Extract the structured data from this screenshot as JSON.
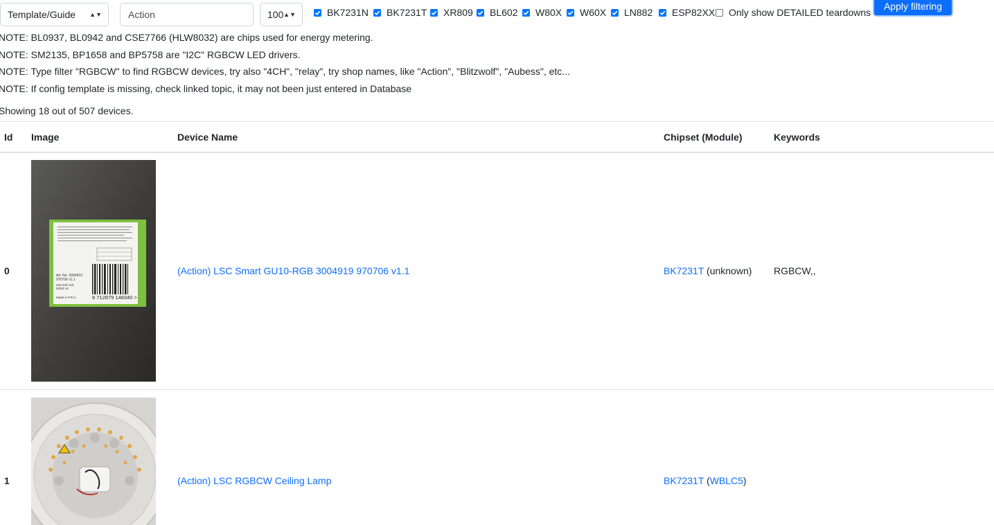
{
  "filters": {
    "template_select": "Template/Guide",
    "search_value": "Action",
    "page_size": "100",
    "chips": [
      {
        "label": "BK7231N",
        "checked": true
      },
      {
        "label": "BK7231T",
        "checked": true
      },
      {
        "label": "XR809",
        "checked": true
      },
      {
        "label": "BL602",
        "checked": true
      },
      {
        "label": "W80X",
        "checked": true
      },
      {
        "label": "W60X",
        "checked": true
      },
      {
        "label": "LN882",
        "checked": true
      },
      {
        "label": "ESP82XX",
        "checked": true
      }
    ],
    "detailed_only_label": "Only show DETAILED teardowns",
    "apply_label": "Apply filtering"
  },
  "notes": [
    "NOTE: BL0937, BL0942 and CSE7766 (HLW8032) are chips used for energy metering.",
    "NOTE: SM2135, BP1658 and BP5758 are \"I2C\" RGBCW LED drivers.",
    "NOTE: Type filter \"RGBCW\" to find RGBCW devices, try also \"4CH\", \"relay\", try shop names, like \"Action\", \"Blitzwolf\", \"Aubess\", etc...",
    "NOTE: If config template is missing, check linked topic, it may not been just entered in Database"
  ],
  "summary": "Showing 18 out of 507 devices.",
  "table": {
    "headers": {
      "id": "Id",
      "image": "Image",
      "name": "Device Name",
      "chipset": "Chipset (Module)",
      "keywords": "Keywords"
    },
    "rows": [
      {
        "id": "0",
        "name": "(Action) LSC Smart GU10-RGB 3004919 970706 v1.1",
        "chip": "BK7231T",
        "module_prefix": " (",
        "module": "unknown",
        "module_suffix": ")",
        "module_linked": false,
        "keywords": "RGBCW,,"
      },
      {
        "id": "1",
        "name": "(Action) LSC RGBCW Ceiling Lamp",
        "chip": "BK7231T",
        "module_prefix": " (",
        "module": "WBLC5",
        "module_suffix": ")",
        "module_linked": true,
        "keywords": ""
      }
    ]
  },
  "photo_text": {
    "art_no": "Art. No. 3004919",
    "version": "970706 v1.1",
    "voltage": "220-240 Volt",
    "frequency": "50/60 Hz",
    "origin": "Made in P.R.C.",
    "barcode": "8 712879 148340 >"
  },
  "colors": {
    "link": "#0d6efd",
    "checkbox": "#0075ff",
    "button": "#0d6efd",
    "rule": "#dee2e6"
  }
}
